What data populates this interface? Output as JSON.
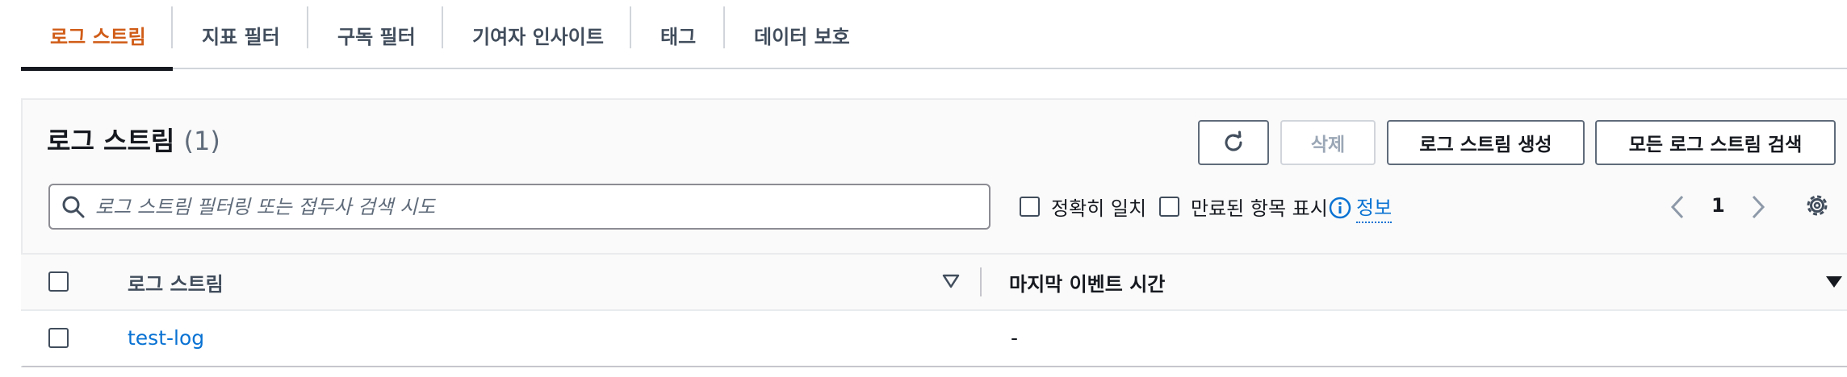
{
  "tabs": [
    {
      "label": "로그 스트림",
      "active": true
    },
    {
      "label": "지표 필터",
      "active": false
    },
    {
      "label": "구독 필터",
      "active": false
    },
    {
      "label": "기여자 인사이트",
      "active": false
    },
    {
      "label": "태그",
      "active": false
    },
    {
      "label": "데이터 보호",
      "active": false
    }
  ],
  "header": {
    "title": "로그 스트림",
    "count": "(1)",
    "refresh_icon": "refresh-icon",
    "delete_label": "삭제",
    "create_label": "로그 스트림 생성",
    "search_all_label": "모든 로그 스트림 검색"
  },
  "filter": {
    "placeholder": "로그 스트림 필터링 또는 접두사 검색 시도",
    "value": "",
    "exact_match_label": "정확히 일치",
    "show_expired_label": "만료된 항목 표시",
    "info_label": "정보"
  },
  "pagination": {
    "current_page": "1"
  },
  "table": {
    "columns": [
      "로그 스트림",
      "마지막 이벤트 시간"
    ],
    "rows": [
      {
        "name": "test-log",
        "last_event": "-"
      }
    ]
  },
  "colors": {
    "active_tab": "#d05c17",
    "link": "#0972d3",
    "text": "#16191f"
  }
}
